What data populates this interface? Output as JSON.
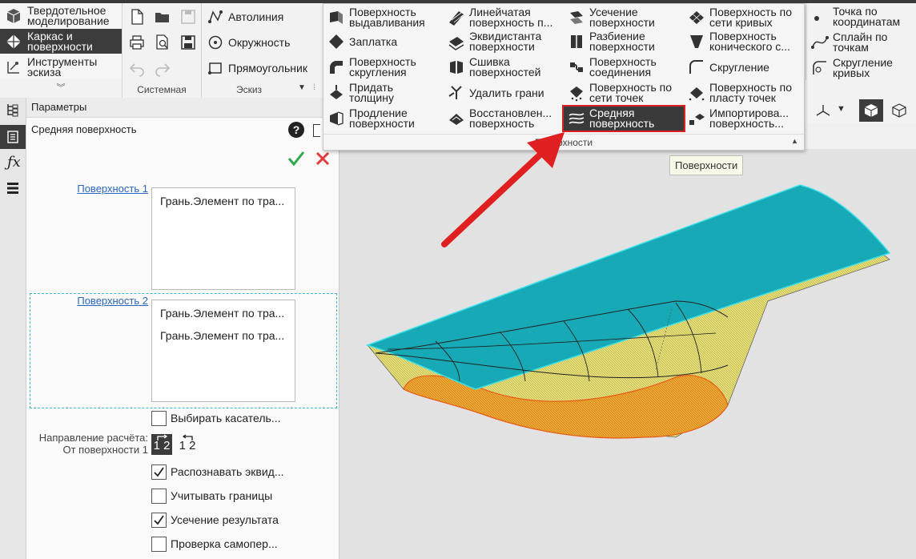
{
  "modes": [
    {
      "label_line1": "Твердотельное",
      "label_line2": "моделирование",
      "icon": "solid-modeling-icon"
    },
    {
      "label_line1": "Каркас и",
      "label_line2": "поверхности",
      "icon": "wireframe-surfaces-icon"
    },
    {
      "label_line1": "Инструменты",
      "label_line2": "эскиза",
      "icon": "sketch-tools-icon"
    }
  ],
  "groups": {
    "system": "Системная",
    "sketch": "Эскиз",
    "surfaces": "Поверхности"
  },
  "sketch_tools": [
    "Автолиния",
    "Окружность",
    "Прямоугольник"
  ],
  "surface_items": [
    {
      "l1": "Поверхность",
      "l2": "выдавливания"
    },
    {
      "l1": "Заплатка",
      "l2": ""
    },
    {
      "l1": "Поверхность",
      "l2": "скругления"
    },
    {
      "l1": "Придать",
      "l2": "толщину"
    },
    {
      "l1": "Продление",
      "l2": "поверхности"
    },
    {
      "l1": "Линейчатая",
      "l2": "поверхность п..."
    },
    {
      "l1": "Эквидистанта",
      "l2": "поверхности"
    },
    {
      "l1": "Сшивка",
      "l2": "поверхностей"
    },
    {
      "l1": "Удалить грани",
      "l2": ""
    },
    {
      "l1": "Восстановлен...",
      "l2": "поверхность"
    },
    {
      "l1": "Усечение",
      "l2": "поверхности"
    },
    {
      "l1": "Разбиение",
      "l2": "поверхности"
    },
    {
      "l1": "Поверхность",
      "l2": "соединения"
    },
    {
      "l1": "Поверхность по",
      "l2": "сети точек"
    },
    {
      "l1": "Средняя",
      "l2": "поверхность"
    },
    {
      "l1": "Поверхность по",
      "l2": "сети кривых"
    },
    {
      "l1": "Поверхность",
      "l2": "конического с..."
    },
    {
      "l1": "Скругление",
      "l2": ""
    },
    {
      "l1": "Поверхность по",
      "l2": "пласту точек"
    },
    {
      "l1": "Импортирова...",
      "l2": "поверхность..."
    }
  ],
  "right_tools": [
    {
      "l1": "Точка по",
      "l2": "координатам"
    },
    {
      "l1": "Сплайн по",
      "l2": "точкам"
    },
    {
      "l1": "Скругление",
      "l2": "кривых"
    }
  ],
  "panel": {
    "header": "Параметры",
    "title": "Средняя поверхность",
    "surface1_label": "Поверхность 1",
    "surface1_items": [
      "Грань.Элемент по тра..."
    ],
    "surface2_label": "Поверхность 2",
    "surface2_items": [
      "Грань.Элемент по тра...",
      "Грань.Элемент по тра..."
    ],
    "opt_tangent": "Выбирать касатель...",
    "direction_label": "Направление расчёта:",
    "direction_value": "От поверхности 1",
    "opt_equidistant": "Распознавать эквид...",
    "opt_bounds": "Учитывать границы",
    "opt_trim": "Усечение результата",
    "opt_selfcheck": "Проверка самопер..."
  },
  "tooltip": "Поверхности",
  "colors": {
    "accent_red": "#e02020",
    "confirm_green": "#2ea84a",
    "cancel_red": "#e33a3a",
    "surface_cyan": "#17a9b5",
    "body_yellow": "#e6df7a",
    "face_orange": "#f0a028"
  }
}
